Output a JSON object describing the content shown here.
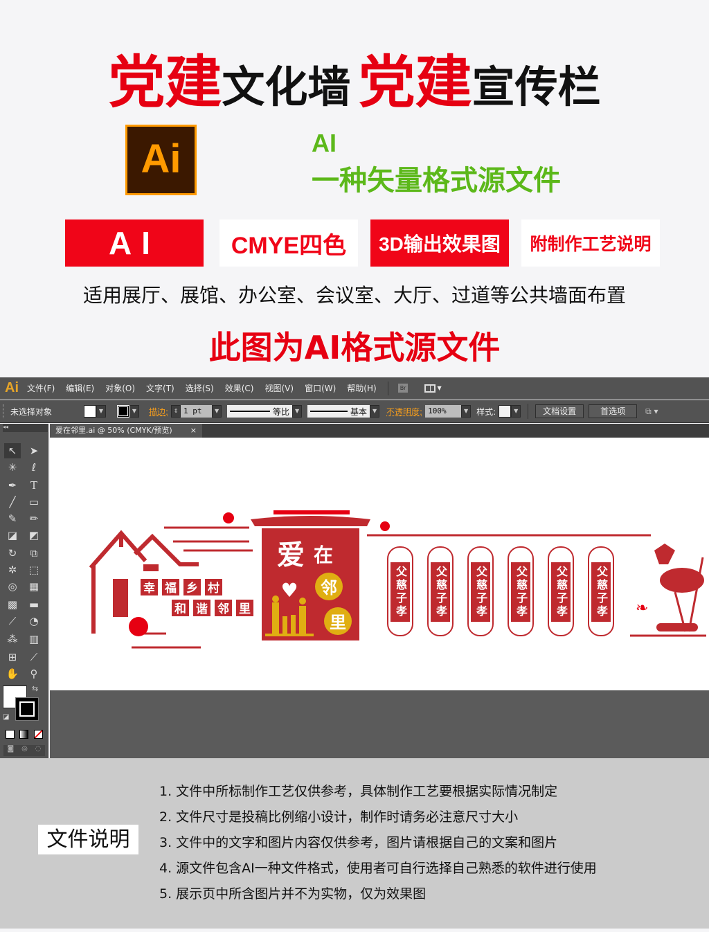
{
  "promo": {
    "title_parts": [
      {
        "text": "党建",
        "style": "red"
      },
      {
        "text": "文化墙",
        "style": "black"
      },
      {
        "text": "党建",
        "style": "red"
      },
      {
        "text": "宣传栏",
        "style": "black"
      }
    ],
    "ai_logo": "Ai",
    "format_label": "AI",
    "format_desc": "一种矢量格式源文件",
    "badges": [
      "AI",
      "CMYE四色",
      "3D输出效果图",
      "附制作工艺说明"
    ],
    "usage": "适用展厅、展馆、办公室、会议室、大厅、过道等公共墙面布置",
    "source_note": "此图为AI格式源文件",
    "colors": {
      "red": "#e60012",
      "green": "#5cb81a",
      "ai_orange": "#ff9a00",
      "artwork_red": "#bf2a2f",
      "gold": "#e0ae12"
    }
  },
  "app": {
    "logo": "Ai",
    "menu": [
      "文件(F)",
      "编辑(E)",
      "对象(O)",
      "文字(T)",
      "选择(S)",
      "效果(C)",
      "视图(V)",
      "窗口(W)",
      "帮助(H)"
    ],
    "bridge": "Br",
    "control": {
      "selection": "未选择对象",
      "stroke_label": "描边:",
      "stroke_value": "1 pt",
      "profile1": "等比",
      "profile2": "基本",
      "opacity_label": "不透明度:",
      "opacity_value": "100%",
      "style_label": "样式:",
      "doc_setup": "文档设置",
      "preferences": "首选项"
    },
    "tab": {
      "title": "爱在邻里.ai @ 50% (CMYK/预览)",
      "close": "×"
    },
    "artwork": {
      "house_words_1": [
        "幸",
        "福",
        "乡",
        "村"
      ],
      "house_words_2": [
        "和",
        "谐",
        "邻",
        "里"
      ],
      "panel_title": [
        "爱",
        "在"
      ],
      "medallions": [
        "邻",
        "里"
      ],
      "scrolls": [
        "父慈子孝",
        "父慈子孝",
        "父慈子孝",
        "父慈子孝",
        "父慈子孝",
        "父慈子孝"
      ]
    }
  },
  "notes": {
    "heading": "文件说明",
    "items": [
      "1. 文件中所标制作工艺仅供参考，具体制作工艺要根据实际情况制定",
      "2. 文件尺寸是投稿比例缩小设计，制作时请务必注意尺寸大小",
      "3. 文件中的文字和图片内容仅供参考，图片请根据自己的文案和图片",
      "4. 源文件包含AI一种文件格式，使用者可自行选择自己熟悉的软件进行使用",
      "5. 展示页中所含图片并不为实物，仅为效果图"
    ]
  }
}
